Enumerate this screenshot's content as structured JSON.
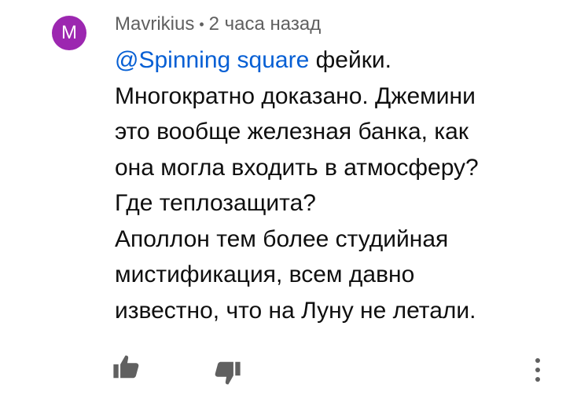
{
  "comment": {
    "avatar_letter": "M",
    "avatar_color": "#9c27b0",
    "author": "Mavrikius",
    "separator": "•",
    "time": "2 часа назад",
    "mention": "@Spinning square",
    "lines": [
      " фейки.",
      "Многократно доказано. Джемини",
      "это вообще железная банка, как",
      "она могла входить в атмосферу?",
      "Где теплозащита?",
      "Аполлон тем более студийная",
      "мистификация, всем давно",
      "известно, что на Луну не летали."
    ]
  },
  "actions": {
    "like_icon": "thumbs-up-icon",
    "dislike_icon": "thumbs-down-icon",
    "menu_icon": "more-vertical-icon"
  },
  "colors": {
    "mention": "#065fd4",
    "meta_text": "#606060",
    "body_text": "#0f0f0f",
    "icon": "#606060"
  }
}
